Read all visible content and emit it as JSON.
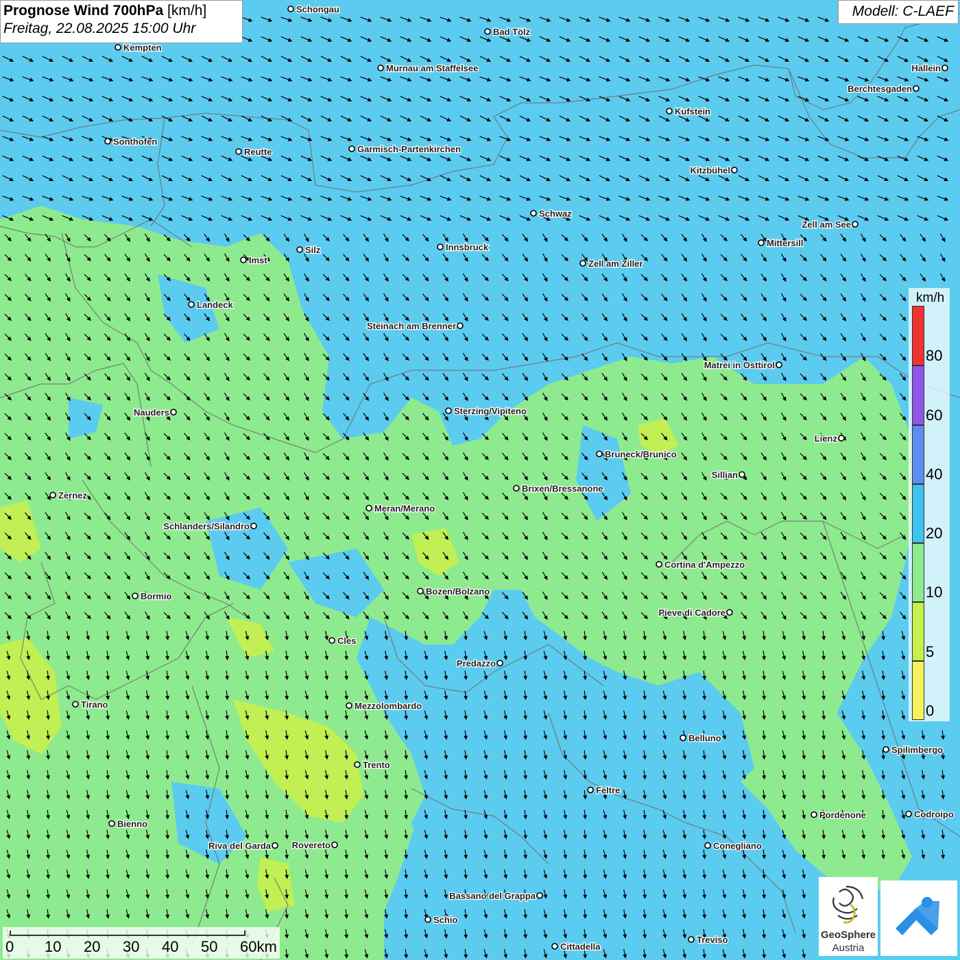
{
  "header": {
    "title": "Prognose Wind 700hPa",
    "unit": "[km/h]",
    "datetime": "Freitag, 22.08.2025 15:00 Uhr",
    "model": "Modell: C-LAEF"
  },
  "legend": {
    "unit": "km/h",
    "classes": [
      {
        "from": 80,
        "to": 90,
        "color": "#f23333"
      },
      {
        "from": 60,
        "to": 80,
        "color": "#9055e8"
      },
      {
        "from": 40,
        "to": 60,
        "color": "#5b8ef0"
      },
      {
        "from": 20,
        "to": 40,
        "color": "#3cc3f0"
      },
      {
        "from": 10,
        "to": 20,
        "color": "#8eea8e"
      },
      {
        "from": 5,
        "to": 10,
        "color": "#c6f04e"
      },
      {
        "from": 0,
        "to": 5,
        "color": "#f6f25c"
      }
    ],
    "ticks": [
      "80",
      "60",
      "40",
      "20",
      "10",
      "5",
      "0"
    ]
  },
  "scale": {
    "labels": [
      "0",
      "10",
      "20",
      "30",
      "40",
      "50",
      "60km"
    ]
  },
  "logo": {
    "name": "GeoSphere",
    "sub": "Austria"
  },
  "cities": [
    {
      "name": "Schongau",
      "label_side": "right"
    },
    {
      "name": "Bad Tölz",
      "label_side": "right"
    },
    {
      "name": "Kempten",
      "label_side": "right"
    },
    {
      "name": "Murnau am Staffelsee",
      "label_side": "right"
    },
    {
      "name": "Hallein",
      "label_side": "left"
    },
    {
      "name": "Berchtesgaden",
      "label_side": "left"
    },
    {
      "name": "Kufstein",
      "label_side": "right"
    },
    {
      "name": "Sonthofen",
      "label_side": "right"
    },
    {
      "name": "Reutte",
      "label_side": "right"
    },
    {
      "name": "Garmisch-Partenkirchen",
      "label_side": "right"
    },
    {
      "name": "Kitzbühel",
      "label_side": "left"
    },
    {
      "name": "Schwaz",
      "label_side": "right"
    },
    {
      "name": "Zell am See",
      "label_side": "left"
    },
    {
      "name": "Mittersill",
      "label_side": "right"
    },
    {
      "name": "Innsbruck",
      "label_side": "right"
    },
    {
      "name": "Silz",
      "label_side": "right"
    },
    {
      "name": "Imst",
      "label_side": "right"
    },
    {
      "name": "Zell am Ziller",
      "label_side": "right"
    },
    {
      "name": "Landeck",
      "label_side": "right"
    },
    {
      "name": "Steinach am Brenner",
      "label_side": "left"
    },
    {
      "name": "Matrei in Osttirol",
      "label_side": "left"
    },
    {
      "name": "Nauders",
      "label_side": "left"
    },
    {
      "name": "Sterzing/Vipiteno",
      "label_side": "right"
    },
    {
      "name": "Lienz",
      "label_side": "left"
    },
    {
      "name": "Bruneck/Brunico",
      "label_side": "right"
    },
    {
      "name": "Sillian",
      "label_side": "left"
    },
    {
      "name": "Brixen/Bressanone",
      "label_side": "right"
    },
    {
      "name": "Zernez",
      "label_side": "right"
    },
    {
      "name": "Meran/Merano",
      "label_side": "right"
    },
    {
      "name": "Schlanders/Silandro",
      "label_side": "left"
    },
    {
      "name": "Cortina d'Ampezzo",
      "label_side": "right"
    },
    {
      "name": "Bozen/Bolzano",
      "label_side": "right"
    },
    {
      "name": "Bormio",
      "label_side": "right"
    },
    {
      "name": "Pieve di Cadore",
      "label_side": "left"
    },
    {
      "name": "Cles",
      "label_side": "right"
    },
    {
      "name": "Predazzo",
      "label_side": "left"
    },
    {
      "name": "Tirano",
      "label_side": "right"
    },
    {
      "name": "Mezzolombardo",
      "label_side": "right"
    },
    {
      "name": "Belluno",
      "label_side": "right"
    },
    {
      "name": "Spilimbergo",
      "label_side": "right"
    },
    {
      "name": "Trento",
      "label_side": "right"
    },
    {
      "name": "Feltre",
      "label_side": "right"
    },
    {
      "name": "Pordenone",
      "label_side": "right"
    },
    {
      "name": "Codroipo",
      "label_side": "right"
    },
    {
      "name": "Bienno",
      "label_side": "right"
    },
    {
      "name": "Riva del Garda",
      "label_side": "left"
    },
    {
      "name": "Rovereto",
      "label_side": "left"
    },
    {
      "name": "Conegliano",
      "label_side": "right"
    },
    {
      "name": "Bassano del Grappa",
      "label_side": "left"
    },
    {
      "name": "Schio",
      "label_side": "right"
    },
    {
      "name": "Treviso",
      "label_side": "right"
    },
    {
      "name": "Cittadella",
      "label_side": "right"
    }
  ]
}
